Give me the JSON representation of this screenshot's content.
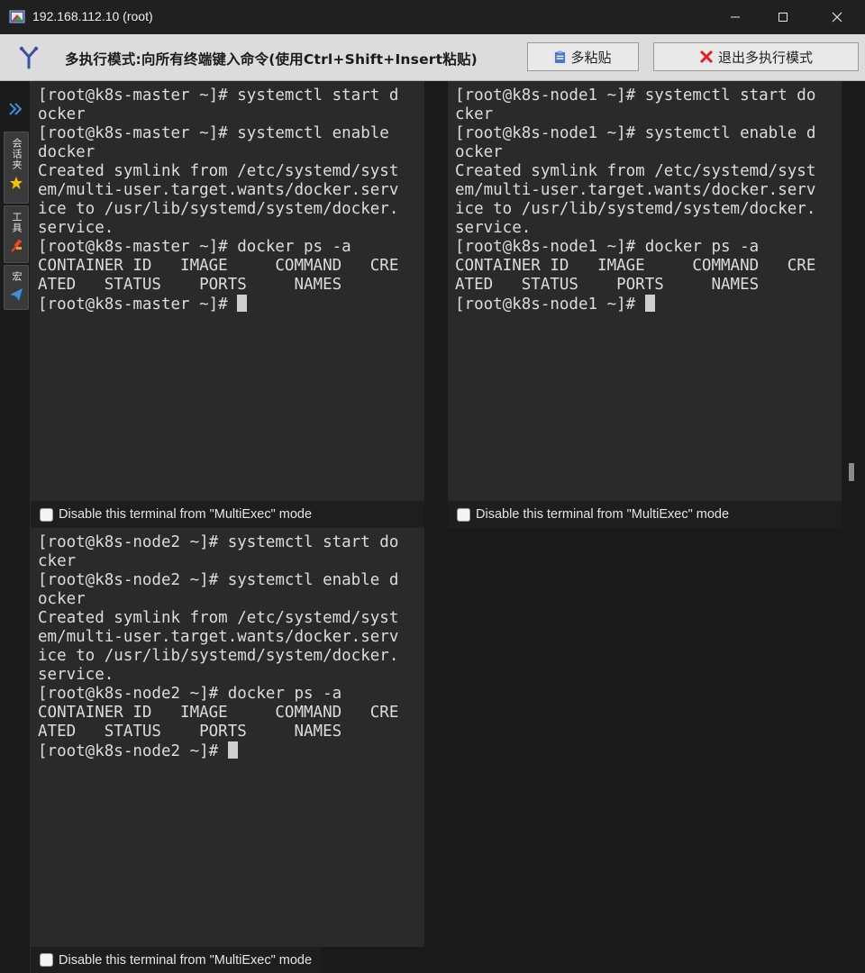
{
  "window": {
    "title": "192.168.112.10 (root)"
  },
  "multiexec": {
    "message": "多执行模式:向所有终端键入命令(使用Ctrl+Shift+Insert粘贴)",
    "paste_label": "多粘贴",
    "exit_label": "退出多执行模式"
  },
  "sidebar": {
    "tabs": [
      {
        "label": "会话夹",
        "icon": "star-icon"
      },
      {
        "label": "工具",
        "icon": "tools-icon"
      },
      {
        "label": "宏",
        "icon": "send-icon"
      }
    ]
  },
  "terminals": [
    {
      "host": "k8s-master",
      "lines": [
        "[root@k8s-master ~]# systemctl start d",
        "ocker",
        "[root@k8s-master ~]# systemctl enable",
        "docker",
        "Created symlink from /etc/systemd/syst",
        "em/multi-user.target.wants/docker.serv",
        "ice to /usr/lib/systemd/system/docker.",
        "service.",
        "[root@k8s-master ~]# docker ps -a",
        "CONTAINER ID   IMAGE     COMMAND   CRE",
        "ATED   STATUS    PORTS     NAMES"
      ],
      "prompt": "[root@k8s-master ~]# "
    },
    {
      "host": "k8s-node1",
      "lines": [
        "[root@k8s-node1 ~]# systemctl start do",
        "cker",
        "[root@k8s-node1 ~]# systemctl enable d",
        "ocker",
        "Created symlink from /etc/systemd/syst",
        "em/multi-user.target.wants/docker.serv",
        "ice to /usr/lib/systemd/system/docker.",
        "service.",
        "[root@k8s-node1 ~]# docker ps -a",
        "CONTAINER ID   IMAGE     COMMAND   CRE",
        "ATED   STATUS    PORTS     NAMES"
      ],
      "prompt": "[root@k8s-node1 ~]# "
    },
    {
      "host": "k8s-node2",
      "lines": [
        "[root@k8s-node2 ~]# systemctl start do",
        "cker",
        "[root@k8s-node2 ~]# systemctl enable d",
        "ocker",
        "Created symlink from /etc/systemd/syst",
        "em/multi-user.target.wants/docker.serv",
        "ice to /usr/lib/systemd/system/docker.",
        "service.",
        "[root@k8s-node2 ~]# docker ps -a",
        "CONTAINER ID   IMAGE     COMMAND   CRE",
        "ATED   STATUS    PORTS     NAMES"
      ],
      "prompt": "[root@k8s-node2 ~]# "
    }
  ],
  "disable_label": "Disable this terminal from \"MultiExec\" mode"
}
